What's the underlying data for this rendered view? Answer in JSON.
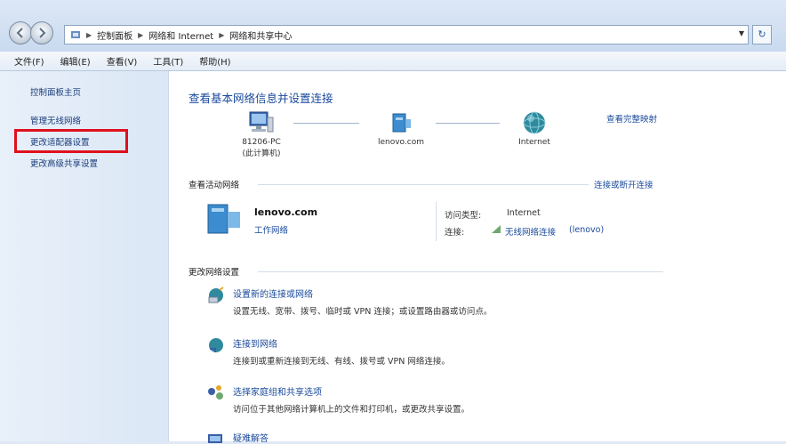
{
  "addressbar": {
    "crumbs": [
      "控制面板",
      "网络和 Internet",
      "网络和共享中心"
    ]
  },
  "menu": [
    "文件(F)",
    "编辑(E)",
    "查看(V)",
    "工具(T)",
    "帮助(H)"
  ],
  "sidebar": {
    "items": [
      "控制面板主页",
      "管理无线网络",
      "更改适配器设置",
      "更改高级共享设置"
    ],
    "highlighted_index": 2
  },
  "main": {
    "title": "查看基本网络信息并设置连接",
    "map_link": "查看完整映射",
    "map": {
      "computer": {
        "name": "81206-PC",
        "sub": "(此计算机)"
      },
      "network": {
        "name": "lenovo.com"
      },
      "internet": {
        "name": "Internet"
      }
    },
    "active_section": {
      "header": "查看活动网络",
      "link": "连接或断开连接",
      "network_name": "lenovo.com",
      "network_type": "工作网络",
      "access_type_label": "访问类型:",
      "access_type_value": "Internet",
      "connections_label": "连接:",
      "connections_value": "无线网络连接",
      "connections_extra": "(lenovo)"
    },
    "change_section": {
      "header": "更改网络设置",
      "tasks": [
        {
          "title": "设置新的连接或网络",
          "desc": "设置无线、宽带、拨号、临时或 VPN 连接；或设置路由器或访问点。"
        },
        {
          "title": "连接到网络",
          "desc": "连接到或重新连接到无线、有线、拨号或 VPN 网络连接。"
        },
        {
          "title": "选择家庭组和共享选项",
          "desc": "访问位于其他网络计算机上的文件和打印机，或更改共享设置。"
        },
        {
          "title": "疑难解答"
        }
      ]
    }
  },
  "colors": {
    "highlight_border": "#e0101e",
    "link": "#1a4a9c"
  }
}
